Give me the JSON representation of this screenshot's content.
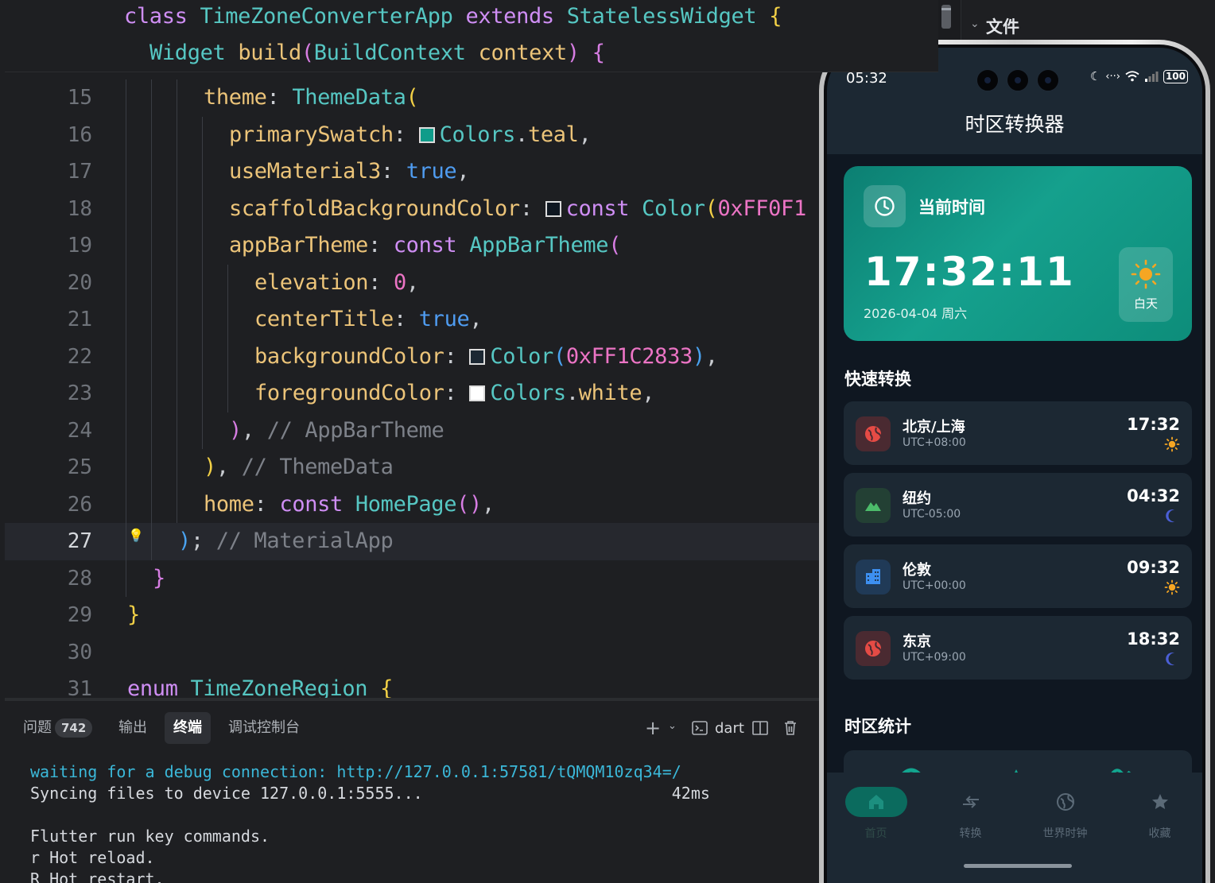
{
  "editor": {
    "sticky": [
      {
        "indent": 0,
        "tokens": [
          [
            "k",
            "class "
          ],
          [
            "t",
            "TimeZoneConverterApp "
          ],
          [
            "k",
            "extends "
          ],
          [
            "t",
            "StatelessWidget "
          ],
          [
            "y",
            "{"
          ]
        ]
      },
      {
        "indent": 1,
        "tokens": [
          [
            "t",
            "Widget "
          ],
          [
            "f",
            "build"
          ],
          [
            "m",
            "("
          ],
          [
            "t",
            "BuildContext "
          ],
          [
            "f",
            "context"
          ],
          [
            "m",
            ")"
          ],
          [
            "p",
            " "
          ],
          [
            "m",
            "{"
          ]
        ]
      }
    ],
    "lines": [
      {
        "num": "15",
        "indent": 3,
        "tokens": [
          [
            "f",
            "theme"
          ],
          [
            "p",
            ": "
          ],
          [
            "t",
            "ThemeData"
          ],
          [
            "y",
            "("
          ]
        ]
      },
      {
        "num": "16",
        "indent": 4,
        "tokens": [
          [
            "f",
            "primarySwatch"
          ],
          [
            "p",
            ": "
          ],
          [
            "sw",
            "#0f9c8a"
          ],
          [
            "t",
            "Colors"
          ],
          [
            "p",
            "."
          ],
          [
            "f",
            "teal"
          ],
          [
            "p",
            ","
          ]
        ]
      },
      {
        "num": "17",
        "indent": 4,
        "tokens": [
          [
            "f",
            "useMaterial3"
          ],
          [
            "p",
            ": "
          ],
          [
            "b",
            "true"
          ],
          [
            "p",
            ","
          ]
        ]
      },
      {
        "num": "18",
        "indent": 4,
        "tokens": [
          [
            "f",
            "scaffoldBackgroundColor"
          ],
          [
            "p",
            ": "
          ],
          [
            "sw",
            "#0f1721"
          ],
          [
            "k",
            "const "
          ],
          [
            "t",
            "Color"
          ],
          [
            "y",
            "("
          ],
          [
            "n",
            "0xFF0F1"
          ]
        ]
      },
      {
        "num": "19",
        "indent": 4,
        "tokens": [
          [
            "f",
            "appBarTheme"
          ],
          [
            "p",
            ": "
          ],
          [
            "k",
            "const "
          ],
          [
            "t",
            "AppBarTheme"
          ],
          [
            "m",
            "("
          ]
        ]
      },
      {
        "num": "20",
        "indent": 5,
        "tokens": [
          [
            "f",
            "elevation"
          ],
          [
            "p",
            ": "
          ],
          [
            "n",
            "0"
          ],
          [
            "p",
            ","
          ]
        ]
      },
      {
        "num": "21",
        "indent": 5,
        "tokens": [
          [
            "f",
            "centerTitle"
          ],
          [
            "p",
            ": "
          ],
          [
            "b",
            "true"
          ],
          [
            "p",
            ","
          ]
        ]
      },
      {
        "num": "22",
        "indent": 5,
        "tokens": [
          [
            "f",
            "backgroundColor"
          ],
          [
            "p",
            ": "
          ],
          [
            "sw",
            "#1c2833"
          ],
          [
            "t",
            "Color"
          ],
          [
            "bl",
            "("
          ],
          [
            "n",
            "0xFF1C2833"
          ],
          [
            "bl",
            ")"
          ],
          [
            "p",
            ","
          ]
        ]
      },
      {
        "num": "23",
        "indent": 5,
        "tokens": [
          [
            "f",
            "foregroundColor"
          ],
          [
            "p",
            ": "
          ],
          [
            "sw",
            "#ffffff"
          ],
          [
            "t",
            "Colors"
          ],
          [
            "p",
            "."
          ],
          [
            "f",
            "white"
          ],
          [
            "p",
            ","
          ]
        ]
      },
      {
        "num": "24",
        "indent": 4,
        "tokens": [
          [
            "m",
            ")"
          ],
          [
            "p",
            ", "
          ],
          [
            "c",
            "// AppBarTheme"
          ]
        ]
      },
      {
        "num": "25",
        "indent": 3,
        "tokens": [
          [
            "y",
            ")"
          ],
          [
            "p",
            ", "
          ],
          [
            "c",
            "// ThemeData"
          ]
        ]
      },
      {
        "num": "26",
        "indent": 3,
        "tokens": [
          [
            "f",
            "home"
          ],
          [
            "p",
            ": "
          ],
          [
            "k",
            "const "
          ],
          [
            "t",
            "HomePage"
          ],
          [
            "m",
            "()"
          ],
          [
            "p",
            ","
          ]
        ]
      },
      {
        "num": "27",
        "indent": 2,
        "tokens": [
          [
            "bl",
            ")"
          ],
          [
            "p",
            "; "
          ],
          [
            "c",
            "// MaterialApp"
          ]
        ],
        "active": true
      },
      {
        "num": "28",
        "indent": 1,
        "tokens": [
          [
            "m",
            "}"
          ]
        ]
      },
      {
        "num": "29",
        "indent": 0,
        "tokens": [
          [
            "y",
            "}"
          ]
        ]
      },
      {
        "num": "30",
        "indent": 0,
        "tokens": []
      },
      {
        "num": "31",
        "indent": 0,
        "tokens": [
          [
            "k",
            "enum "
          ],
          [
            "t",
            "TimeZoneRegion "
          ],
          [
            "y",
            "{"
          ]
        ]
      }
    ]
  },
  "explorer": {
    "title": "文件"
  },
  "panel": {
    "tabs": [
      {
        "label": "问题",
        "badge": "742"
      },
      {
        "label": "输出"
      },
      {
        "label": "终端",
        "active": true
      },
      {
        "label": "调试控制台"
      }
    ],
    "shell_label": "dart",
    "terminal": [
      {
        "text": "waiting for a debug connection: http://127.0.0.1:57581/tQMQM10zq34=/",
        "color": "cyan"
      },
      {
        "text": "Syncing files to device 127.0.0.1:5555...                          42ms",
        "color": "plain"
      },
      {
        "text": "",
        "color": "plain"
      },
      {
        "text": "Flutter run key commands.",
        "color": "plain"
      },
      {
        "text": "r Hot reload.",
        "color": "plain"
      },
      {
        "text": "R Hot restart.",
        "color": "plain"
      }
    ]
  },
  "phone": {
    "status": {
      "time": "05:32",
      "battery": "100"
    },
    "app_title": "时区转换器",
    "current": {
      "label": "当前时间",
      "time": "17:32:11",
      "date": "2026-04-04 周六",
      "period": "白天"
    },
    "quick_title": "快速转换",
    "zones": [
      {
        "name": "北京/上海",
        "offset": "UTC+08:00",
        "time": "17:32",
        "period": "sun",
        "icon": "globe-icon",
        "icon_color": "#e54b45",
        "icon_bg": "#4a2a31"
      },
      {
        "name": "纽约",
        "offset": "UTC-05:00",
        "time": "04:32",
        "period": "moon",
        "icon": "landscape-icon",
        "icon_color": "#4cbb6a",
        "icon_bg": "#234034"
      },
      {
        "name": "伦敦",
        "offset": "UTC+00:00",
        "time": "09:32",
        "period": "sun",
        "icon": "building-icon",
        "icon_color": "#3d8ff0",
        "icon_bg": "#203a57"
      },
      {
        "name": "东京",
        "offset": "UTC+09:00",
        "time": "18:32",
        "period": "moon",
        "icon": "globe-icon",
        "icon_color": "#e54b45",
        "icon_bg": "#4a2a31"
      }
    ],
    "stats_title": "时区统计",
    "nav": [
      {
        "label": "首页",
        "icon": "home-icon",
        "selected": true
      },
      {
        "label": "转换",
        "icon": "swap-icon"
      },
      {
        "label": "世界时钟",
        "icon": "globe-icon"
      },
      {
        "label": "收藏",
        "icon": "star-icon"
      }
    ],
    "colors": {
      "sun": "#f5a623",
      "moon": "#4b5fd6",
      "teal": "#0d8d7a"
    }
  }
}
